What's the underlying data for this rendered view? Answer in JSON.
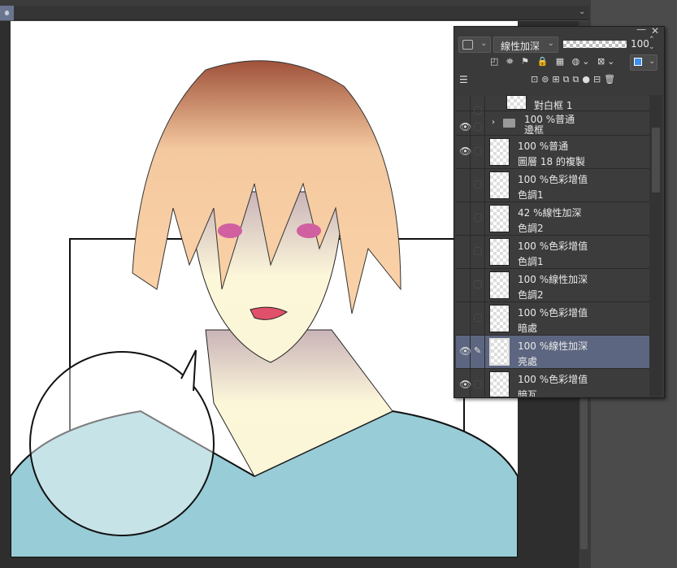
{
  "tabstrip": {
    "chevron": "⌄"
  },
  "panel": {
    "blend_mode": "線性加深",
    "opacity": "100",
    "title_minimize": "—",
    "title_close": "✕",
    "main_color": "#3d8ff0",
    "layers": [
      {
        "line1": "",
        "line2": "對白框 1",
        "visible": false,
        "folder": false,
        "partial": true
      },
      {
        "line1": "100 %普通",
        "line2": "邊框",
        "visible": true,
        "folder": true
      },
      {
        "line1": "100 %普通",
        "line2": "圖層 18 的複製",
        "visible": true
      },
      {
        "line1": "100 %色彩增值",
        "line2": "色調1",
        "visible": false
      },
      {
        "line1": "42 %線性加深",
        "line2": "色調2",
        "visible": false
      },
      {
        "line1": "100 %色彩增值",
        "line2": "色調1",
        "visible": false
      },
      {
        "line1": "100 %線性加深",
        "line2": "色調2",
        "visible": false
      },
      {
        "line1": "100 %色彩增值",
        "line2": "暗處",
        "visible": false
      },
      {
        "line1": "100 %線性加深",
        "line2": "亮處",
        "visible": true,
        "selected": true
      },
      {
        "line1": "100 %色彩增值",
        "line2": "暗瓦",
        "visible": true
      }
    ]
  }
}
